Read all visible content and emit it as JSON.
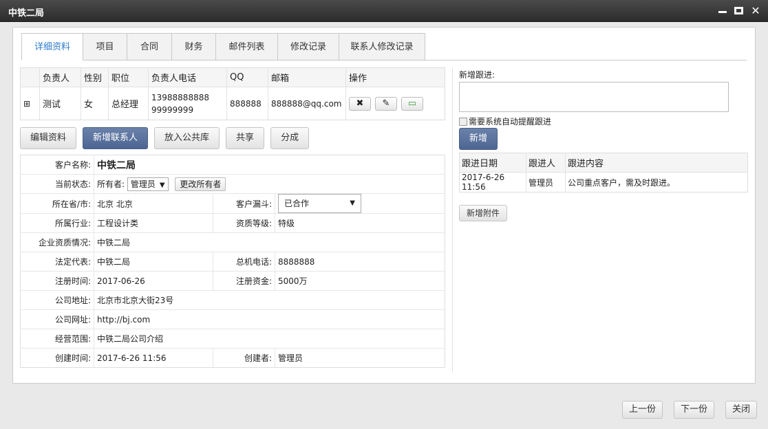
{
  "window": {
    "title": "中铁二局"
  },
  "tabs": [
    "详细资料",
    "项目",
    "合同",
    "财务",
    "邮件列表",
    "修改记录",
    "联系人修改记录"
  ],
  "contacts": {
    "headers": [
      "负责人",
      "性别",
      "职位",
      "负责人电话",
      "QQ",
      "邮箱",
      "操作"
    ],
    "rows": [
      {
        "expand": "⊞",
        "name": "测试",
        "gender": "女",
        "position": "总经理",
        "phone1": "13988888888",
        "phone2": "99999999",
        "qq": "888888",
        "email": "888888@qq.com"
      }
    ]
  },
  "action_buttons": [
    "编辑资料",
    "新增联系人",
    "放入公共库",
    "共享",
    "分成"
  ],
  "details": {
    "customer_name_label": "客户名称:",
    "customer_name": "中铁二局",
    "status_label": "当前状态:",
    "owner_label": "所有者:",
    "owner_value": "管理员",
    "change_owner": "更改所有者",
    "province_label": "所在省/市:",
    "province": "北京 北京",
    "funnel_label": "客户漏斗:",
    "funnel_value": "已合作",
    "industry_label": "所属行业:",
    "industry": "工程设计类",
    "qualification_label": "资质等级:",
    "qualification": "特级",
    "enterprise_label": "企业资质情况:",
    "enterprise": "中铁二局",
    "legal_label": "法定代表:",
    "legal": "中铁二局",
    "switchboard_label": "总机电话:",
    "switchboard": "8888888",
    "reg_time_label": "注册时间:",
    "reg_time": "2017-06-26",
    "reg_capital_label": "注册资金:",
    "reg_capital": "5000万",
    "address_label": "公司地址:",
    "address": "北京市北京大街23号",
    "website_label": "公司网址:",
    "website": "http://bj.com",
    "scope_label": "经营范围:",
    "scope": "中铁二局公司介绍",
    "created_label": "创建时间:",
    "created": "2017-6-26 11:56",
    "creator_label": "创建者:",
    "creator": "管理员"
  },
  "followup": {
    "label": "新增跟进:",
    "remind": "需要系统自动提醒跟进",
    "add": "新增",
    "headers": [
      "跟进日期",
      "跟进人",
      "跟进内容"
    ],
    "rows": [
      {
        "date": "2017-6-26 11:56",
        "person": "管理员",
        "content": "公司重点客户，需及时跟进。"
      }
    ],
    "attach": "新增附件"
  },
  "footer": {
    "prev": "上一份",
    "next": "下一份",
    "close": "关闭"
  }
}
